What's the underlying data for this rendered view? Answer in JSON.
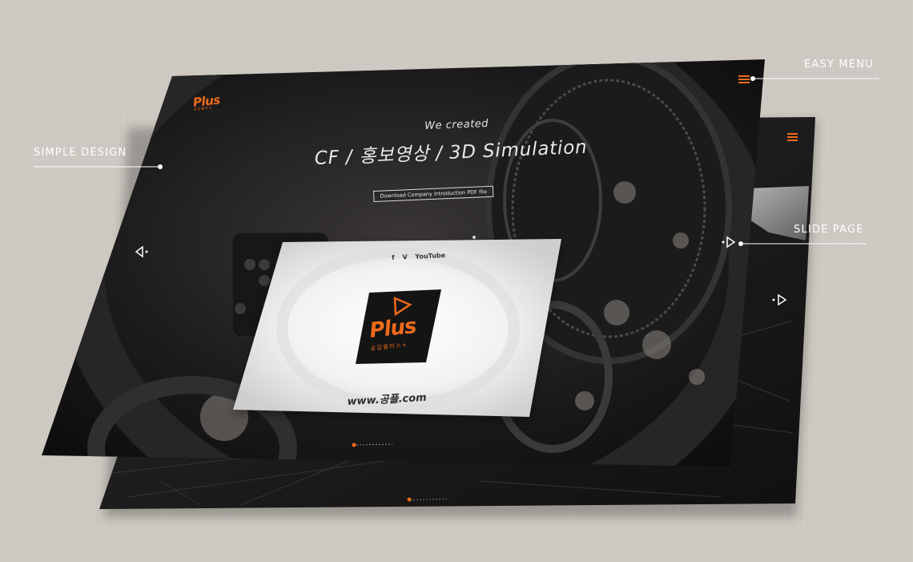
{
  "callouts": {
    "simple_design": "SIMPLE DESIGN",
    "easy_menu": "EASY MENU",
    "slide_page": "SLIDE PAGE"
  },
  "front_screen": {
    "logo_word": "Plus",
    "logo_sub": "공감플러스",
    "tagline": "We created",
    "headline": "CF / 홍보영상 / 3D Simulation",
    "pdf_button": "Download Company Introduction PDF file",
    "menu_icon": "hamburger-menu-icon",
    "prev_icon": "arrow-left-icon",
    "next_icon": "arrow-right-icon"
  },
  "card": {
    "social": [
      "f",
      "V",
      "YouTube"
    ],
    "logo_word": "Plus",
    "logo_sub": "공감플러스+",
    "url": "www.공플.com"
  },
  "colors": {
    "accent": "#f06a1a",
    "background": "#cfcac3",
    "screen": "#141414",
    "callout_line": "#ffffff"
  }
}
